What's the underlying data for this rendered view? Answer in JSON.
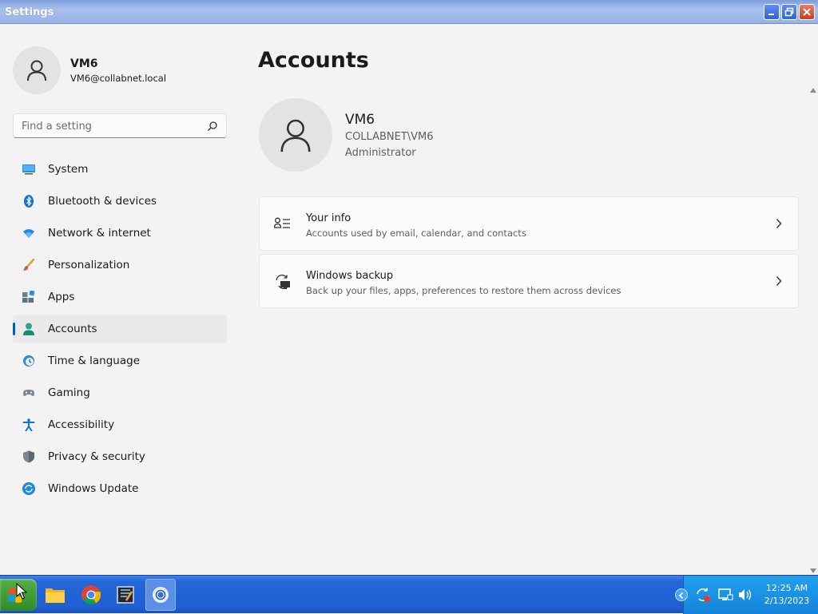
{
  "window": {
    "title": "Settings"
  },
  "user": {
    "name": "VM6",
    "email": "VM6@collabnet.local"
  },
  "search": {
    "placeholder": "Find a setting"
  },
  "nav": {
    "items": [
      {
        "label": "System",
        "icon": "monitor-icon"
      },
      {
        "label": "Bluetooth & devices",
        "icon": "bluetooth-icon"
      },
      {
        "label": "Network & internet",
        "icon": "wifi-icon"
      },
      {
        "label": "Personalization",
        "icon": "brush-icon"
      },
      {
        "label": "Apps",
        "icon": "apps-icon"
      },
      {
        "label": "Accounts",
        "icon": "person-icon",
        "active": true
      },
      {
        "label": "Time & language",
        "icon": "clock-globe-icon"
      },
      {
        "label": "Gaming",
        "icon": "gamepad-icon"
      },
      {
        "label": "Accessibility",
        "icon": "accessibility-icon"
      },
      {
        "label": "Privacy & security",
        "icon": "shield-icon"
      },
      {
        "label": "Windows Update",
        "icon": "update-icon"
      }
    ]
  },
  "main": {
    "title": "Accounts",
    "account": {
      "name": "VM6",
      "domain": "COLLABNET\\VM6",
      "role": "Administrator"
    },
    "cards": [
      {
        "title": "Your info",
        "subtitle": "Accounts used by email, calendar, and contacts",
        "icon": "contact-card-icon"
      },
      {
        "title": "Windows backup",
        "subtitle": "Back up your files, apps, preferences to restore them across devices",
        "icon": "backup-sync-icon"
      }
    ]
  },
  "taskbar": {
    "apps": [
      "file-explorer-icon",
      "chrome-icon",
      "notepad-icon",
      "chrome-active-icon"
    ],
    "clock": {
      "time": "12:25 AM",
      "date": "2/13/2023"
    }
  },
  "colors": {
    "accent": "#005fb8",
    "taskbar": "#1f5fd2",
    "tray": "#1583db"
  }
}
